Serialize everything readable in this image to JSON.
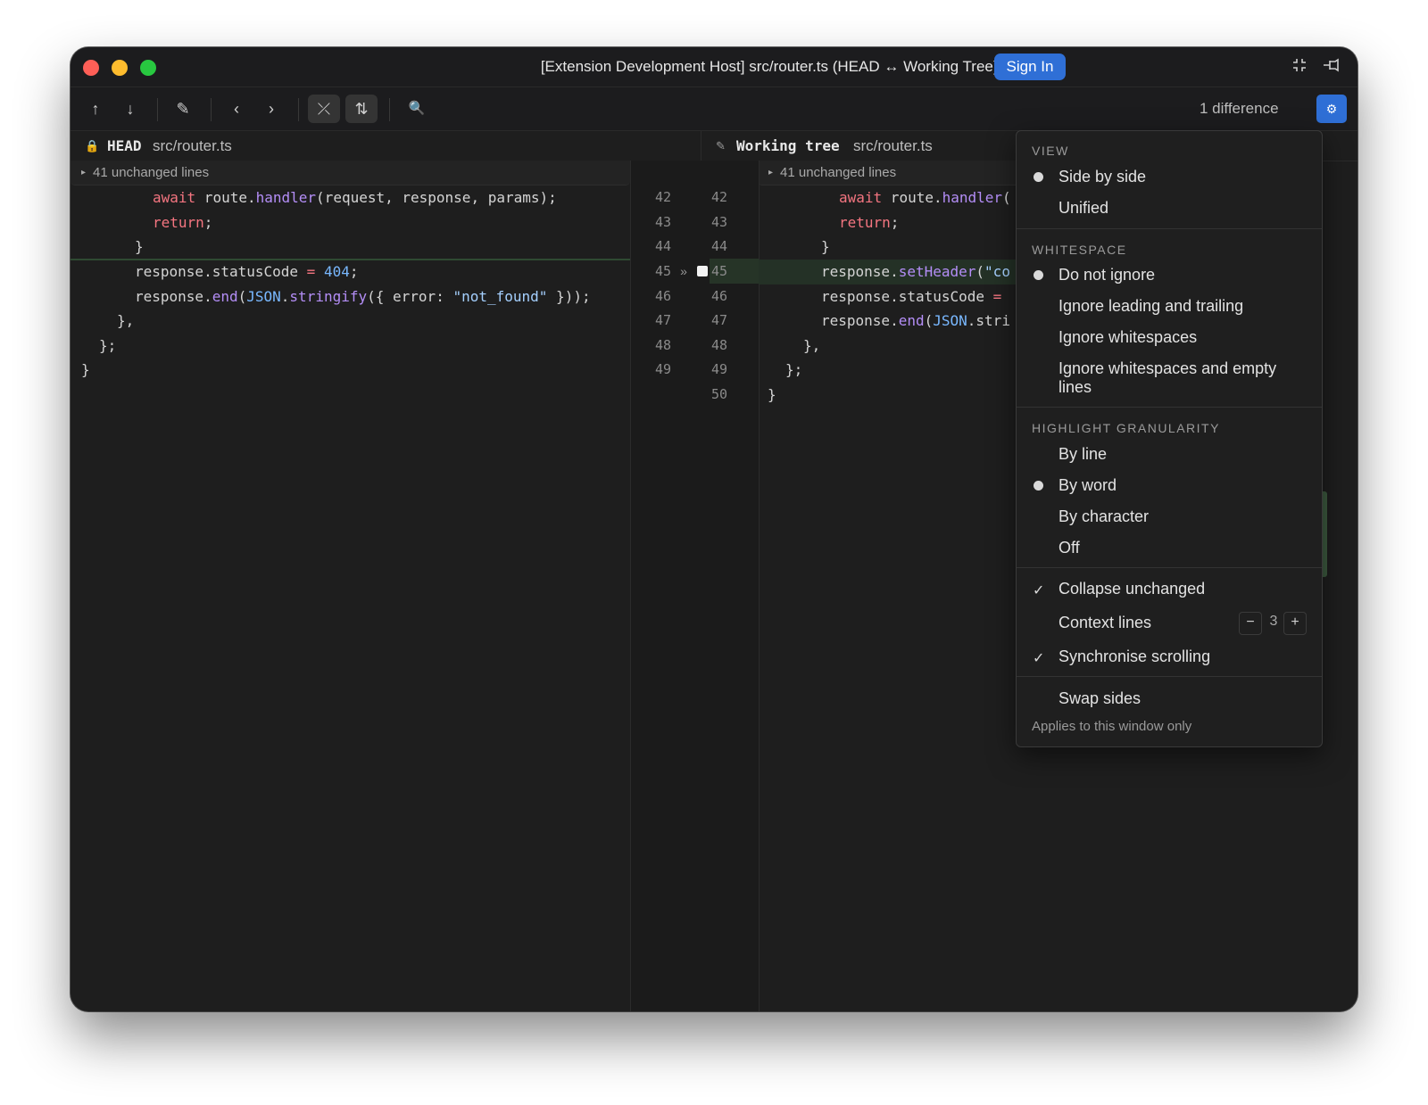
{
  "window": {
    "title": "[Extension Development Host] src/router.ts (HEAD ↔ Working Tree) — repo",
    "sign_in": "Sign In"
  },
  "toolbar": {
    "up_icon": "↑",
    "down_icon": "↓",
    "edit_icon": "✎",
    "prev_icon": "‹",
    "next_icon": "›",
    "collapse_icon": "⤫",
    "swap_icon": "⇅",
    "search_icon": "🔍",
    "diff_count": "1 difference",
    "settings_icon": "⚙"
  },
  "left_pane": {
    "ref": "HEAD",
    "path": "src/router.ts",
    "collapsed": "41 unchanged lines"
  },
  "right_pane": {
    "ref": "Working tree",
    "path": "src/router.ts",
    "collapsed": "41 unchanged lines"
  },
  "gutter": {
    "left_numbers": [
      "42",
      "43",
      "44",
      "45",
      "46",
      "47",
      "48",
      "49"
    ],
    "right_numbers": [
      "42",
      "43",
      "44",
      "45",
      "46",
      "47",
      "48",
      "49",
      "50"
    ],
    "arrow": "»"
  },
  "menu": {
    "view_heading": "VIEW",
    "view_options": [
      "Side by side",
      "Unified"
    ],
    "whitespace_heading": "WHITESPACE",
    "whitespace_options": [
      "Do not ignore",
      "Ignore leading and trailing",
      "Ignore whitespaces",
      "Ignore whitespaces and empty lines"
    ],
    "granularity_heading": "HIGHLIGHT GRANULARITY",
    "granularity_options": [
      "By line",
      "By word",
      "By character",
      "Off"
    ],
    "collapse_unchanged": "Collapse unchanged",
    "context_lines_label": "Context lines",
    "context_lines_value": "3",
    "minus": "−",
    "plus": "+",
    "sync_scrolling": "Synchronise scrolling",
    "swap_sides": "Swap sides",
    "footer": "Applies to this window only",
    "check": "✓"
  }
}
